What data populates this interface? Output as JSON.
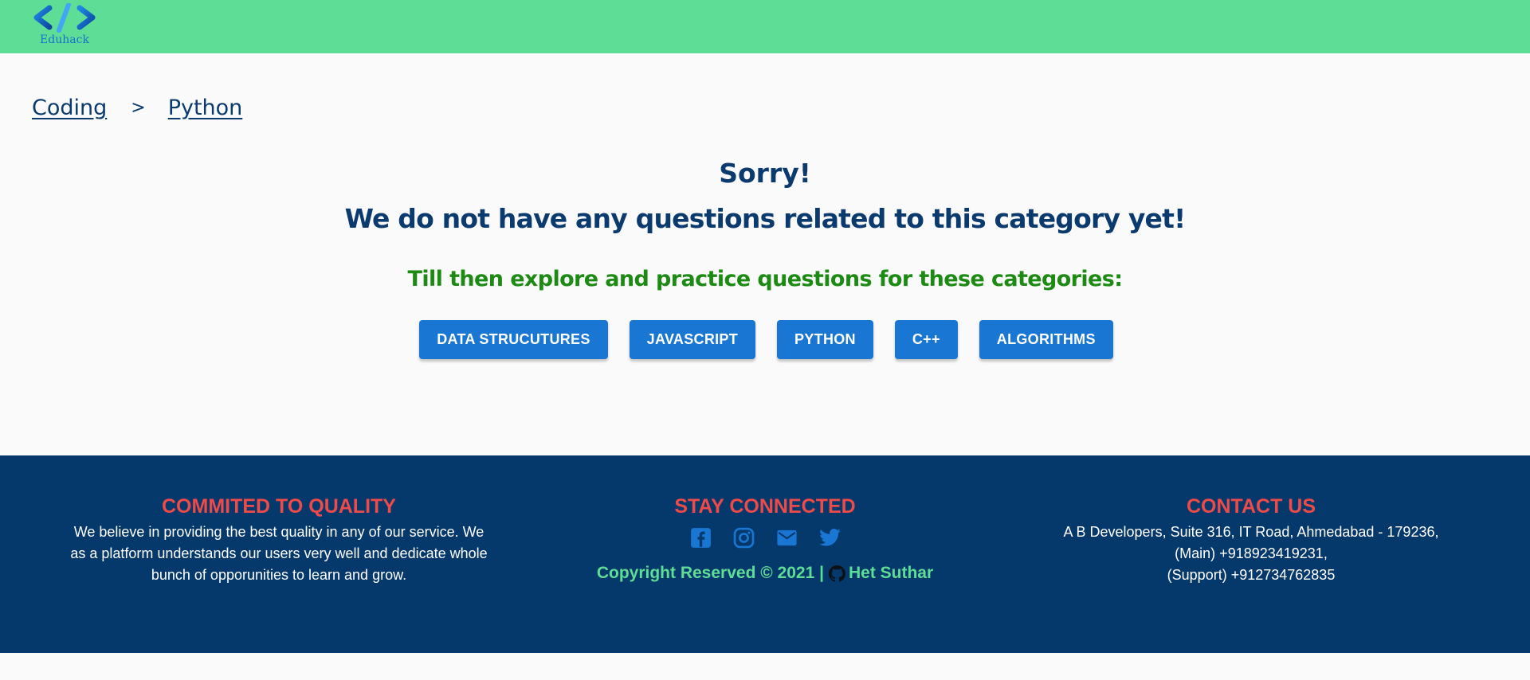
{
  "brand": {
    "name": "Eduhack",
    "color_primary": "#5ddd95",
    "color_dark": "#05386b",
    "color_accent": "#1976d2"
  },
  "breadcrumb": {
    "items": [
      "Coding",
      "Python"
    ],
    "separator": ">"
  },
  "message": {
    "sorry": "Sorry!",
    "no_questions": "We do not have any questions related to this category yet!",
    "till_then": "Till then explore and practice questions for these categories:"
  },
  "categories": [
    "DATA STRUCUTURES",
    "JAVASCRIPT",
    "PYTHON",
    "C++",
    "ALGORITHMS"
  ],
  "footer": {
    "quality": {
      "heading": "COMMITED TO QUALITY",
      "lines": [
        "We believe in providing the best quality in any of our service. We",
        "as a platform understands our users very well and dedicate whole",
        "bunch of opporunities to learn and grow."
      ]
    },
    "connected": {
      "heading": "STAY CONNECTED",
      "icons": [
        "facebook-icon",
        "instagram-icon",
        "mail-icon",
        "twitter-icon"
      ],
      "copyright_prefix": "Copyright Reserved © 2021 |",
      "author": "Het Suthar"
    },
    "contact": {
      "heading": "CONTACT US",
      "lines": [
        "A B Developers, Suite 316, IT Road, Ahmedabad - 179236,",
        "(Main) +918923419231,",
        "(Support) +912734762835"
      ]
    }
  }
}
